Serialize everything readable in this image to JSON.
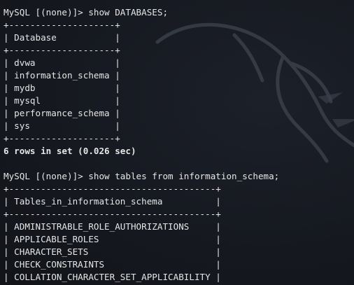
{
  "terminal": {
    "command1": "MySQL [(none)]> show DATABASES;",
    "db_table": {
      "border": "+--------------------+",
      "header": "| Database           |",
      "rows": [
        "| dvwa               |",
        "| information_schema |",
        "| mydb               |",
        "| mysql              |",
        "| performance_schema |",
        "| sys                |"
      ]
    },
    "result1": "6 rows in set (0.026 sec)",
    "command2": "MySQL [(none)]> show tables from information_schema;",
    "tables_table": {
      "border": "+---------------------------------------+",
      "header": "| Tables_in_information_schema          |",
      "rows": [
        "| ADMINISTRABLE_ROLE_AUTHORIZATIONS     |",
        "| APPLICABLE_ROLES                      |",
        "| CHARACTER_SETS                        |",
        "| CHECK_CONSTRAINTS                     |",
        "| COLLATION_CHARACTER_SET_APPLICABILITY |"
      ]
    }
  },
  "colors": {
    "background": "#15181f",
    "text": "#e6e6e6",
    "watermark": "#3a3f4a"
  },
  "icons": {
    "watermark": "kali-dragon-icon"
  }
}
